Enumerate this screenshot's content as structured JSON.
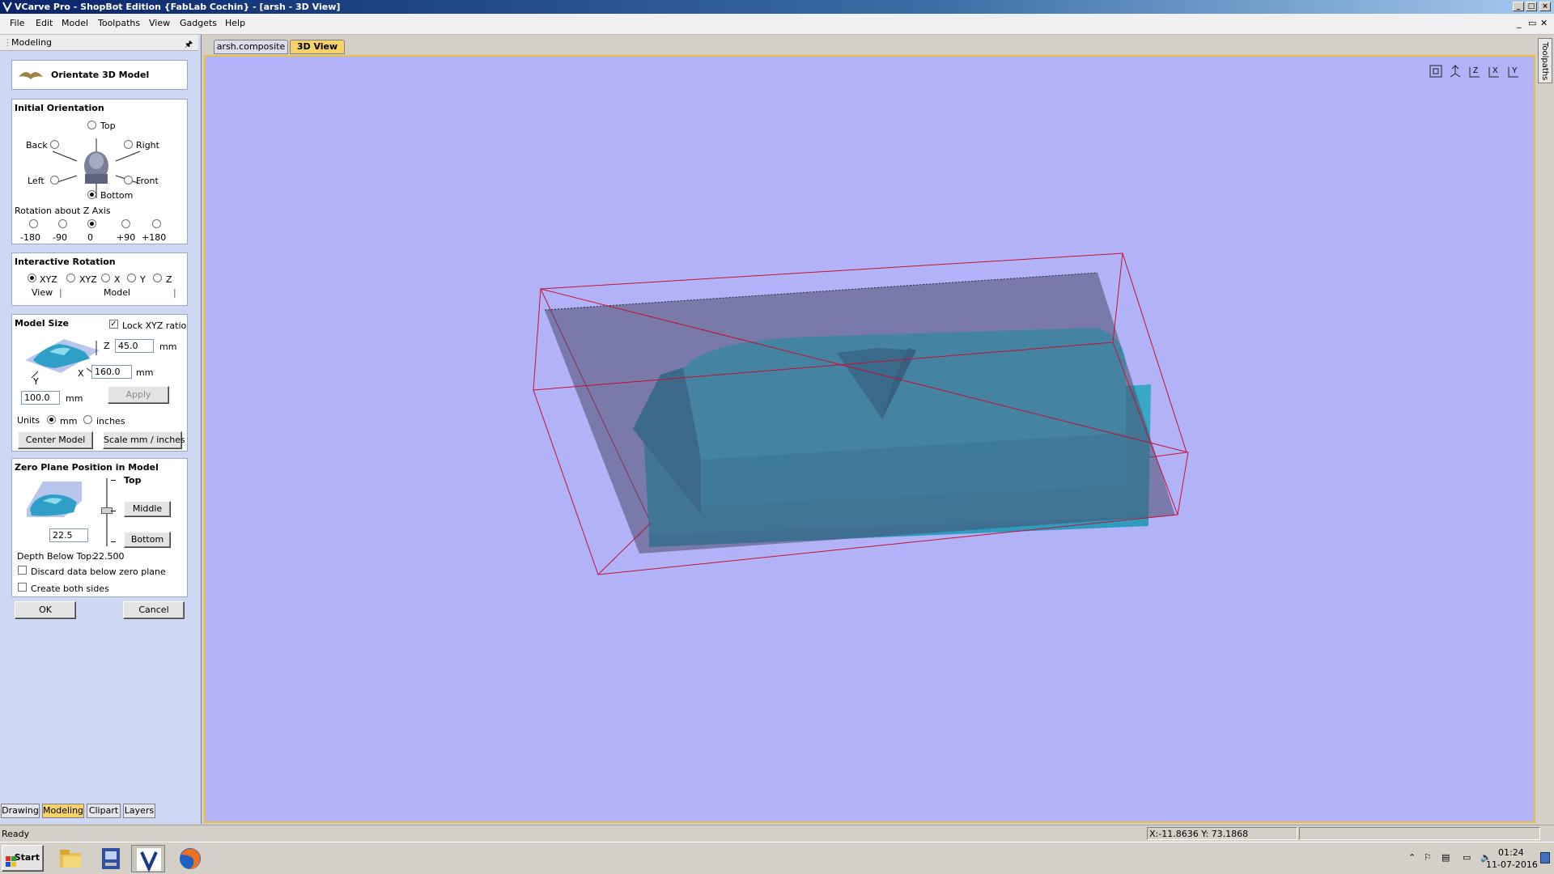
{
  "window": {
    "title": "VCarve Pro - ShopBot Edition {FabLab Cochin} - [arsh - 3D View]"
  },
  "menu": [
    "File",
    "Edit",
    "Model",
    "Toolpaths",
    "View",
    "Gadgets",
    "Help"
  ],
  "panel": {
    "title": "Modeling",
    "pin_glyph": " "
  },
  "orient": {
    "title": "Orientate 3D Model"
  },
  "initial": {
    "title": "Initial Orientation",
    "top": "Top",
    "back": "Back",
    "right": "Right",
    "left": "Left",
    "front": "Front",
    "bottom": "Bottom",
    "selected": "Bottom",
    "rotation_label": "Rotation about Z Axis",
    "rotations": [
      "-180",
      "-90",
      "0",
      "+90",
      "+180"
    ],
    "rotation_selected": "0"
  },
  "interactive": {
    "title": "Interactive Rotation",
    "options": [
      "XYZ",
      "XYZ",
      "X",
      "Y",
      "Z"
    ],
    "selected": "XYZ",
    "view_label": "View",
    "model_label": "Model"
  },
  "size": {
    "title": "Model Size",
    "lock_label": "Lock XYZ ratio",
    "lock_checked": true,
    "z_label": "Z",
    "z_value": "45.0",
    "x_label": "X",
    "x_value": "160.0",
    "y_label": "Y",
    "y_value": "100.0",
    "unit": "mm",
    "apply": "Apply",
    "units_label": "Units",
    "unit_mm": "mm",
    "unit_inches": "inches",
    "units_selected": "mm",
    "center_model": "Center Model",
    "scale": "Scale mm / inches"
  },
  "zero": {
    "title": "Zero Plane Position in Model",
    "top": "Top",
    "middle": "Middle",
    "bottom": "Bottom",
    "value": "22.5",
    "depth_label": "Depth Below Top:",
    "depth_value": "22.500",
    "discard_label": "Discard data below zero plane",
    "both_sides_label": "Create both sides"
  },
  "actions": {
    "ok": "OK",
    "cancel": "Cancel"
  },
  "bottom_tabs": [
    "Drawing",
    "Modeling",
    "Clipart",
    "Layers"
  ],
  "bottom_active": "Modeling",
  "doc_tabs": [
    "arsh.composite",
    "3D View"
  ],
  "doc_active": "3D View",
  "view_icons": [
    "fit-icon",
    "iso-icon",
    "z-view-icon",
    "x-view-icon",
    "y-view-icon"
  ],
  "side_tab": "Toolpaths",
  "status": {
    "text": "Ready",
    "coords": "X:-11.8636 Y: 73.1868"
  },
  "taskbar": {
    "start": "Start",
    "time": "01:24",
    "date": "11-07-2016"
  },
  "colors": {
    "viewport": "#b2b2f8",
    "model": "#3ec8e8",
    "bbox": "#c8102e",
    "accent": "#f7d26a"
  }
}
